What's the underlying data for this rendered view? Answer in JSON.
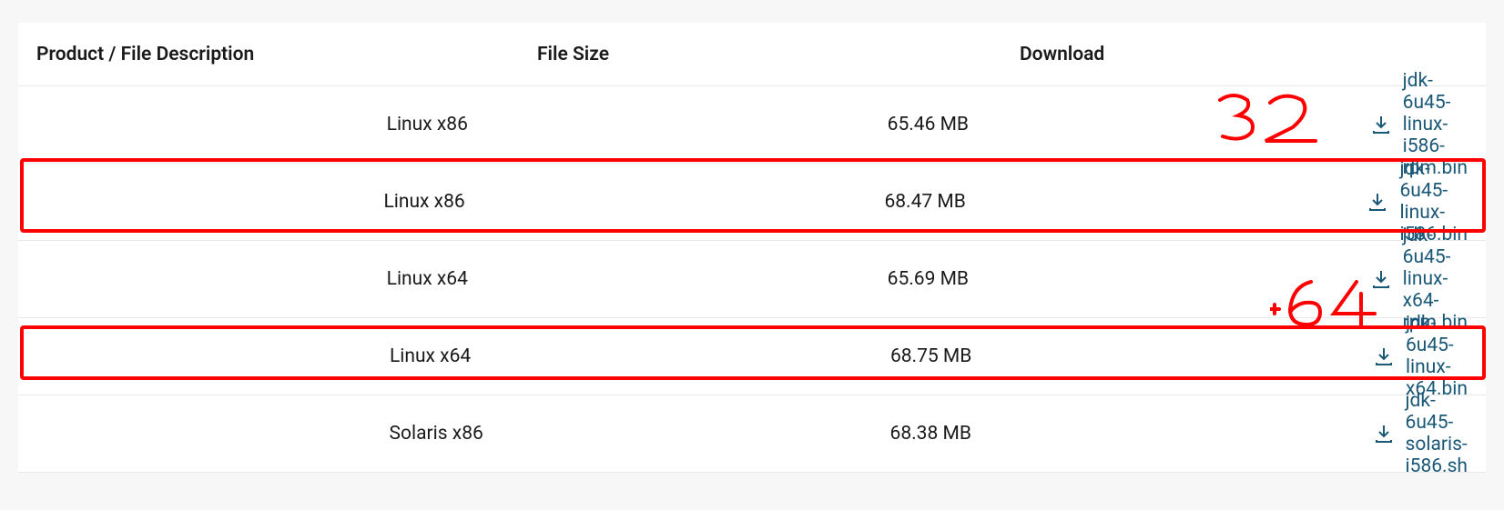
{
  "columns": {
    "product": "Product / File Description",
    "size": "File Size",
    "download": "Download"
  },
  "rows": [
    {
      "product": "Linux x86",
      "size": "65.46 MB",
      "file": "jdk-6u45-linux-i586-rpm.bin"
    },
    {
      "product": "Linux x86",
      "size": "68.47 MB",
      "file": "jdk-6u45-linux-i586.bin"
    },
    {
      "product": "Linux x64",
      "size": "65.69 MB",
      "file": "jdk-6u45-linux-x64-rpm.bin"
    },
    {
      "product": "Linux x64",
      "size": "68.75 MB",
      "file": "jdk-6u45-linux-x64.bin"
    },
    {
      "product": "Solaris x86",
      "size": "68.38 MB",
      "file": "jdk-6u45-solaris-i586.sh"
    }
  ],
  "annotations": {
    "label32": "32",
    "label64": "64"
  }
}
